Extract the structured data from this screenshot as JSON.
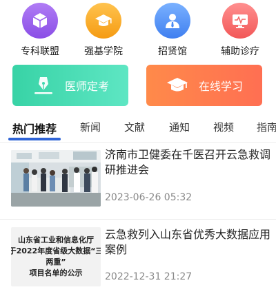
{
  "quick_links": [
    {
      "label": "专科联盟",
      "icon": "cube-icon",
      "color": "#9b63ee"
    },
    {
      "label": "强基学院",
      "icon": "graduation-cap-icon",
      "color": "#f7a623"
    },
    {
      "label": "招贤馆",
      "icon": "person-tie-icon",
      "color": "#4a8af4"
    },
    {
      "label": "辅助诊疗",
      "icon": "monitor-heartbeat-icon",
      "color": "#f46464"
    }
  ],
  "cards": [
    {
      "label": "医师定考",
      "icon": "pen-nib-icon",
      "color": "#42d8b0"
    },
    {
      "label": "在线学习",
      "icon": "graduation-cap-icon",
      "color": "#ff7a4d"
    }
  ],
  "tabs": [
    {
      "label": "热门推荐",
      "active": true
    },
    {
      "label": "新闻"
    },
    {
      "label": "文献"
    },
    {
      "label": "通知"
    },
    {
      "label": "视频"
    },
    {
      "label": "指南"
    }
  ],
  "news": [
    {
      "title": "济南市卫健委在千医召开云急救调研推进会",
      "date": "2023-06-26 05:32"
    },
    {
      "title": "云急救列入山东省优秀大数据应用案例",
      "date": "2022-12-31 21:27",
      "thumb_lines": [
        "山东省工业和信息化厅",
        "于2022年度省级大数据“三",
        "两重”",
        "项目名单的公示"
      ]
    }
  ]
}
